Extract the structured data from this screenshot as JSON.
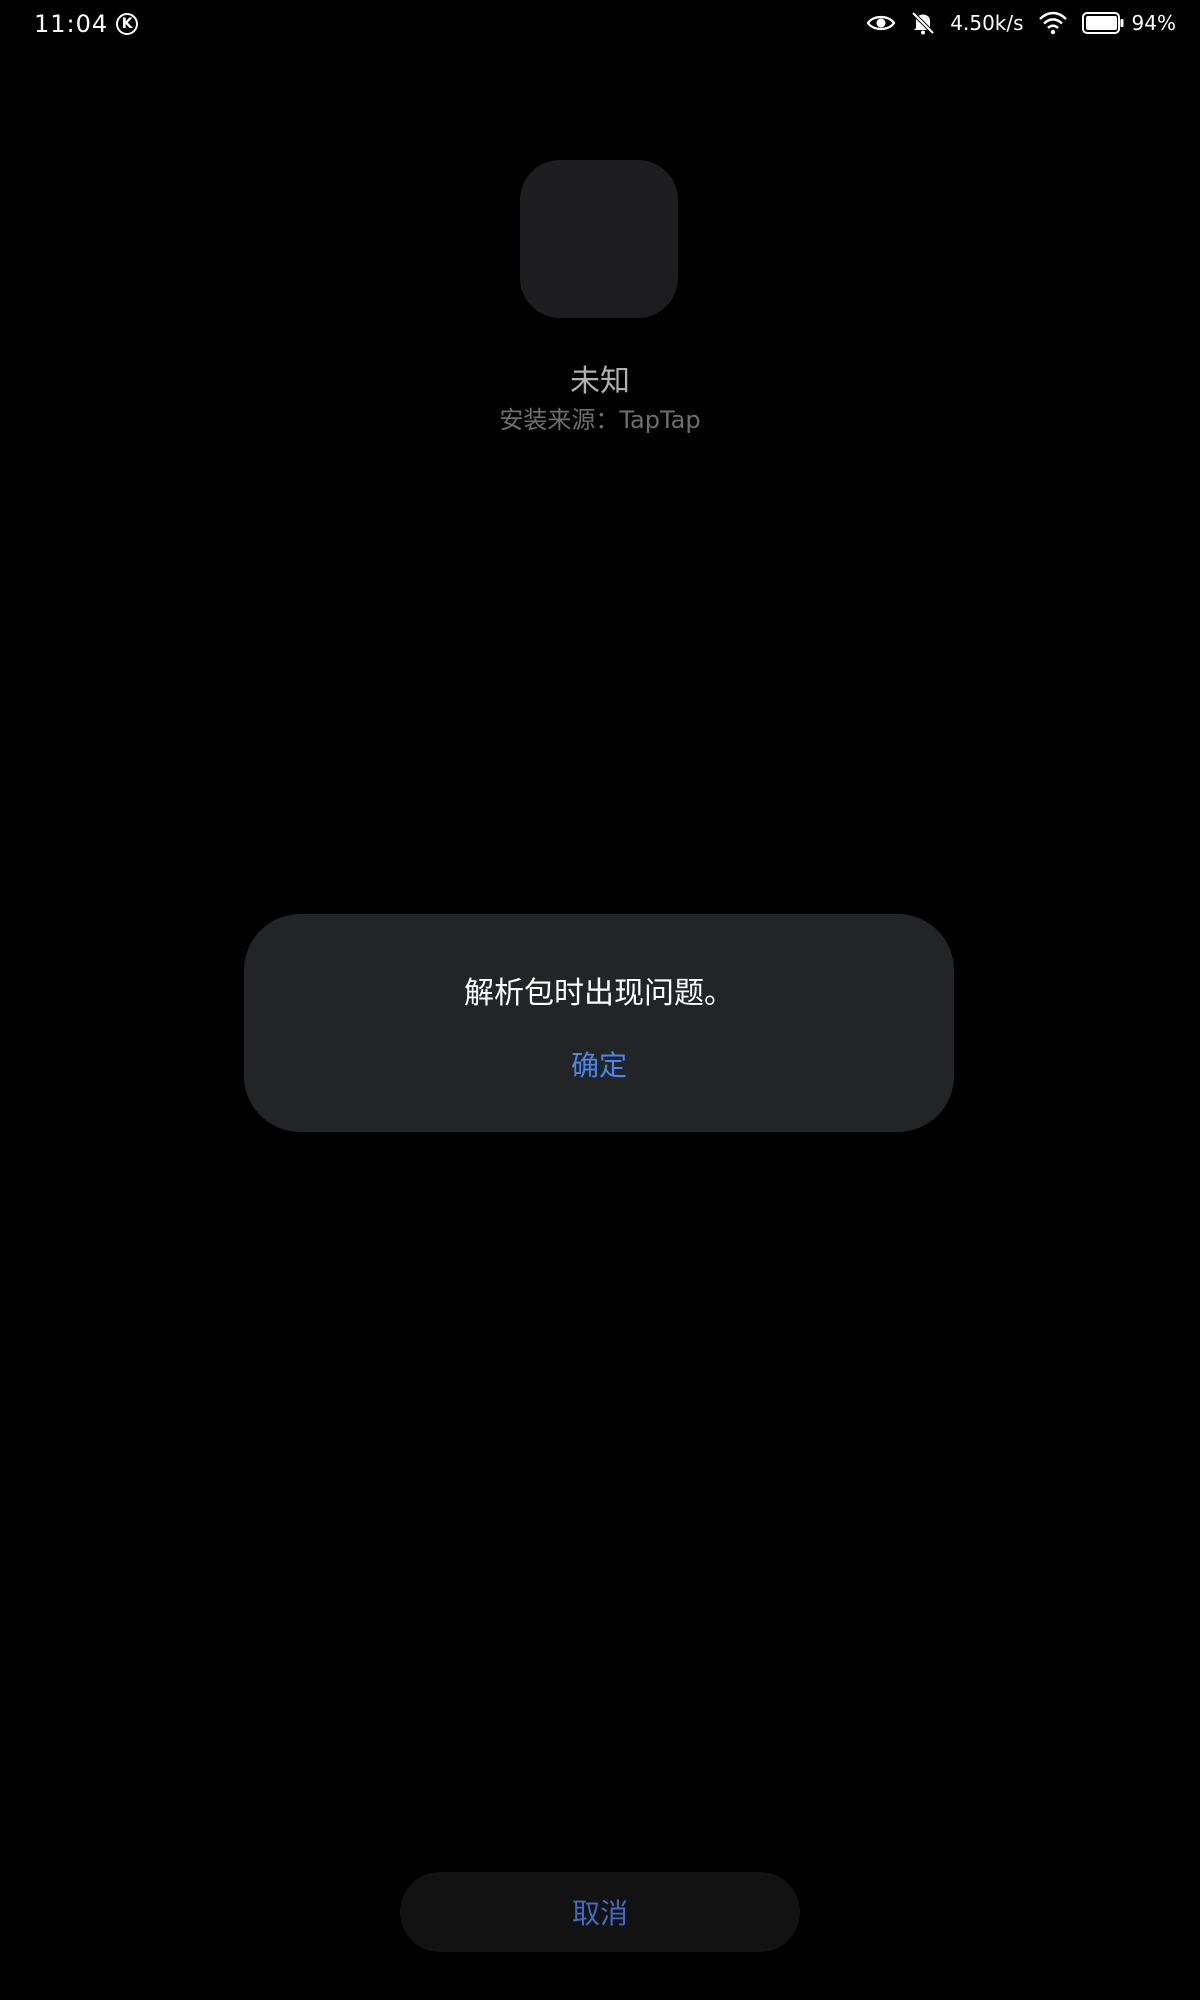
{
  "status_bar": {
    "time": "11:04",
    "k_badge": "K",
    "net_speed": "4.50k/s",
    "battery": "94%",
    "icons": [
      "eye-icon",
      "bell-off-icon",
      "wifi-icon",
      "battery-icon"
    ]
  },
  "app": {
    "name": "未知",
    "install_source": "安装来源：TapTap"
  },
  "dialog": {
    "message": "解析包时出现问题。",
    "ok_label": "确定"
  },
  "bottom": {
    "cancel_label": "取消"
  },
  "colors": {
    "background": "#000000",
    "dialog_bg": "#232426",
    "accent": "#4a86e8",
    "cancel_text": "#3f6cc2",
    "icon_placeholder": "#1d1d1f"
  }
}
